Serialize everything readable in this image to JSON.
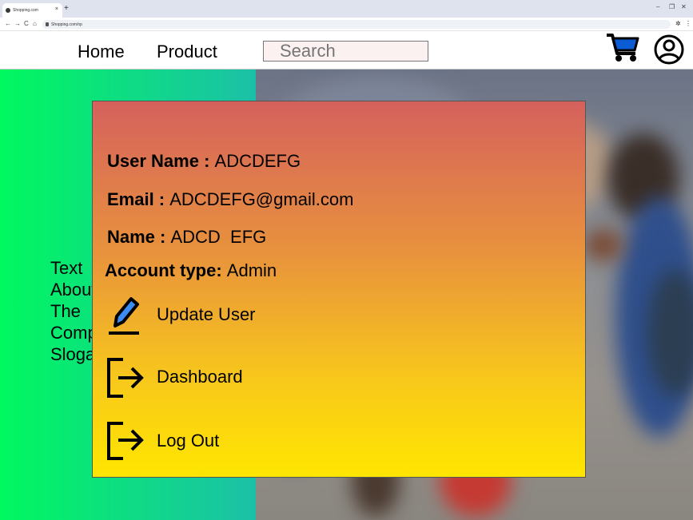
{
  "browser": {
    "tab_title": "Shopping.com",
    "url": "Shopping.com/np",
    "tab_close": "×",
    "new_tab": "+",
    "win_min": "–",
    "win_restore": "❐",
    "win_close": "✕",
    "nav_back": "←",
    "nav_forward": "→",
    "nav_reload": "C",
    "nav_home": "⌂",
    "ext": "✲",
    "menu": "⋮"
  },
  "nav": {
    "home": "Home",
    "product": "Product",
    "search_placeholder": "Search"
  },
  "hero": {
    "slogan": "Text About The Company Slogan"
  },
  "profile": {
    "username_label": "User Name : ",
    "username_value": "ADCDEFG",
    "email_label": "Email : ",
    "email_value": "ADCDEFG@gmail.com",
    "name_label": "Name : ",
    "name_value": "ADCD  EFG",
    "account_label": "Account type: ",
    "account_value": "Admin"
  },
  "menu": {
    "update_user": "Update User",
    "dashboard": "Dashboard",
    "log_out": "Log Out"
  },
  "colors": {
    "cart": "#0b5bd3",
    "pen": "#3b8cf3"
  }
}
